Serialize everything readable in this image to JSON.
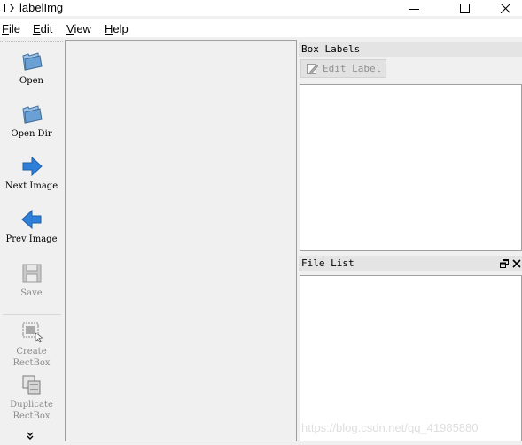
{
  "window": {
    "title": "labelImg",
    "icon": "labelimg-tag-icon"
  },
  "menu": [
    {
      "mnemonic": "F",
      "rest": "ile"
    },
    {
      "mnemonic": "E",
      "rest": "dit"
    },
    {
      "mnemonic": "V",
      "rest": "iew"
    },
    {
      "mnemonic": "H",
      "rest": "elp"
    }
  ],
  "toolbar": {
    "open": {
      "label": "Open",
      "icon": "folder-open-icon"
    },
    "open_dir": {
      "label": "Open Dir",
      "icon": "folder-open-icon"
    },
    "next_image": {
      "label": "Next Image",
      "icon": "arrow-right-icon"
    },
    "prev_image": {
      "label": "Prev Image",
      "icon": "arrow-left-icon"
    },
    "save": {
      "label": "Save",
      "icon": "floppy-disk-icon",
      "enabled": false
    },
    "create_rectbox": {
      "label": "Create\nRectBox",
      "icon": "create-rectbox-icon",
      "enabled": false
    },
    "duplicate_rectbox": {
      "label": "Duplicate\nRectBox",
      "icon": "duplicate-rectbox-icon",
      "enabled": false
    },
    "more": {
      "icon": "chevron-double-down-icon"
    }
  },
  "box_labels_dock": {
    "title": "Box Labels",
    "edit_label_button": "Edit Label",
    "edit_label_enabled": false
  },
  "file_list_dock": {
    "title": "File List"
  },
  "watermark": "https://blog.csdn.net/qq_41985880",
  "colors": {
    "window_bg": "#f0f0f0",
    "arrow_blue": "#2f7fd8",
    "folder_blue": "#5b93c9",
    "disabled_text": "#8a8a8a"
  }
}
